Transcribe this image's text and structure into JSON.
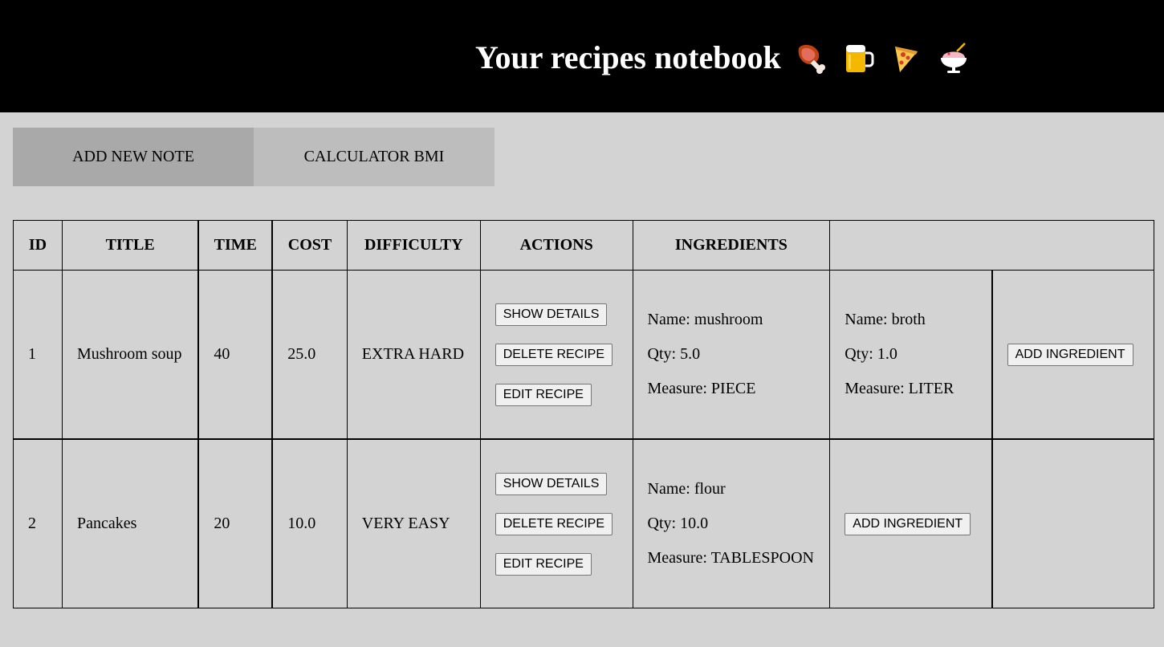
{
  "header": {
    "title": "Your recipes notebook",
    "emojis": [
      "meat-on-bone-icon",
      "beer-mug-icon",
      "pizza-icon",
      "shaved-ice-icon"
    ]
  },
  "tabs": [
    {
      "label": "ADD NEW NOTE",
      "active": true
    },
    {
      "label": "CALCULATOR BMI",
      "active": false
    }
  ],
  "table": {
    "headers": [
      "ID",
      "TITLE",
      "TIME",
      "COST",
      "DIFFICULTY",
      "ACTIONS",
      "INGREDIENTS",
      ""
    ],
    "rows": [
      {
        "id": "1",
        "title": "Mushroom soup",
        "time": "40",
        "cost": "25.0",
        "difficulty": "EXTRA HARD",
        "actions": [
          "SHOW DETAILS",
          "DELETE RECIPE",
          "EDIT RECIPE"
        ],
        "ingredients": [
          {
            "name": "Name: mushroom",
            "qty": "Qty: 5.0",
            "measure": "Measure: PIECE"
          },
          {
            "name": "Name: broth",
            "qty": "Qty: 1.0",
            "measure": "Measure: LITER"
          }
        ],
        "add_ingredient": "ADD INGREDIENT"
      },
      {
        "id": "2",
        "title": "Pancakes",
        "time": "20",
        "cost": "10.0",
        "difficulty": "VERY EASY",
        "actions": [
          "SHOW DETAILS",
          "DELETE RECIPE",
          "EDIT RECIPE"
        ],
        "ingredients": [
          {
            "name": "Name: flour",
            "qty": "Qty: 10.0",
            "measure": "Measure: TABLESPOON"
          }
        ],
        "add_ingredient": "ADD INGREDIENT"
      }
    ]
  }
}
